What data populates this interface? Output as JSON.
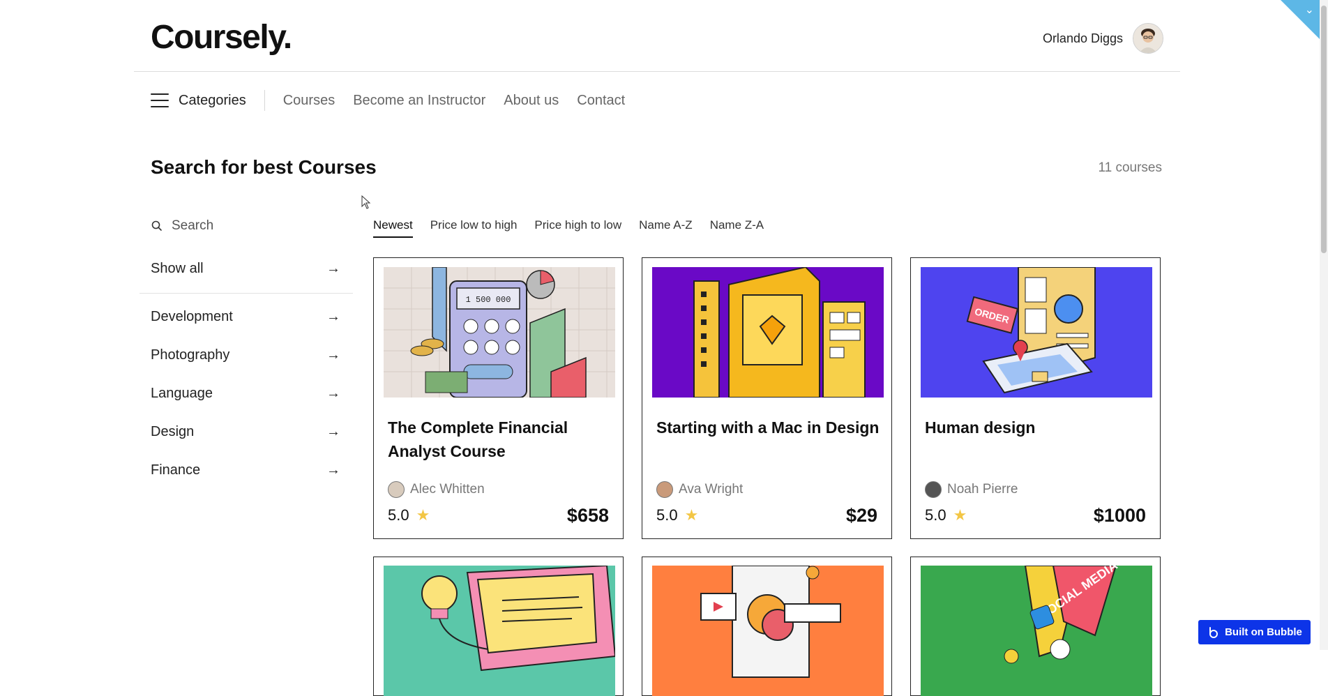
{
  "header": {
    "logo": "Coursely.",
    "user_name": "Orlando Diggs"
  },
  "nav": {
    "categories_label": "Categories",
    "links": [
      "Courses",
      "Become an Instructor",
      "About us",
      "Contact"
    ]
  },
  "page": {
    "title": "Search for best Courses",
    "count": "11 courses"
  },
  "search": {
    "placeholder": "Search"
  },
  "sidebar": {
    "show_all": "Show all",
    "categories": [
      "Development",
      "Photography",
      "Language",
      "Design",
      "Finance"
    ]
  },
  "sort_tabs": [
    "Newest",
    "Price low to high",
    "Price high to low",
    "Name A-Z",
    "Name Z-A"
  ],
  "sort_active": "Newest",
  "courses": [
    {
      "title": "The Complete Financial Analyst Course",
      "author": "Alec Whitten",
      "rating": "5.0",
      "price": "$658",
      "image_text": "1 500 000"
    },
    {
      "title": "Starting with a Mac in Design",
      "author": "Ava Wright",
      "rating": "5.0",
      "price": "$29"
    },
    {
      "title": "Human design",
      "author": "Noah Pierre",
      "rating": "5.0",
      "price": "$1000",
      "image_text": "ORDER"
    }
  ],
  "partial_card_images": [
    {
      "image_text": ""
    },
    {
      "image_text": ""
    },
    {
      "image_text": "SOCIAL MEDIA"
    }
  ],
  "badge": {
    "label": "Built on Bubble"
  },
  "colors": {
    "accent_blue": "#0d34e8",
    "star": "#f3c645",
    "corner": "#5db7e6"
  }
}
